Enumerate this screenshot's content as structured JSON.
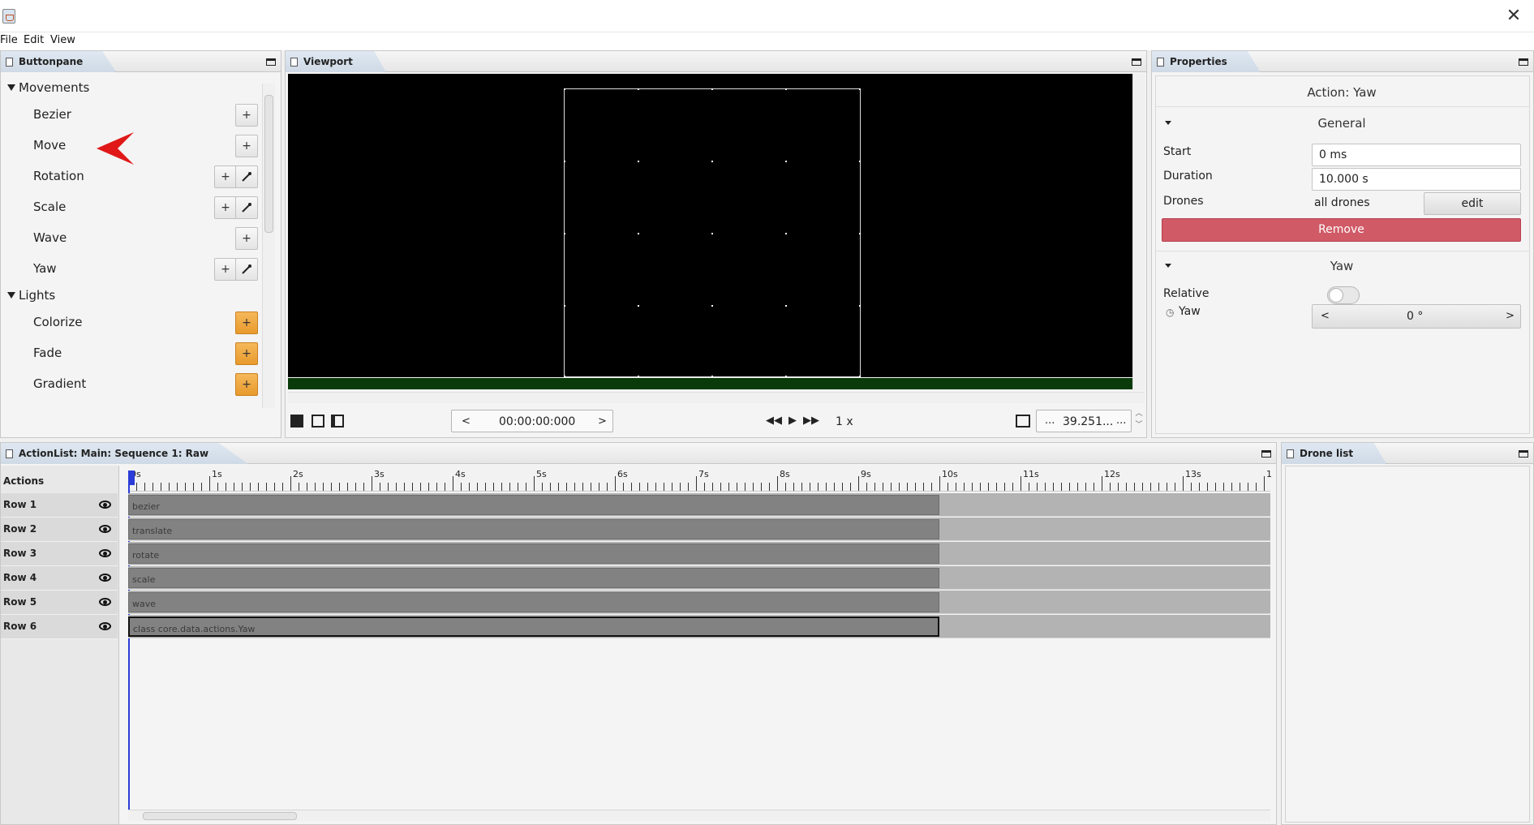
{
  "window": {
    "close_glyph": "✕"
  },
  "menu": [
    "File",
    "Edit",
    "View"
  ],
  "buttonpane": {
    "tab": "Buttonpane",
    "categories": [
      {
        "label": "Movements",
        "items": [
          {
            "label": "Bezier",
            "buttons": [
              "+"
            ]
          },
          {
            "label": "Move",
            "buttons": [
              "+"
            ]
          },
          {
            "label": "Rotation",
            "buttons": [
              "+",
              "pick"
            ]
          },
          {
            "label": "Scale",
            "buttons": [
              "+",
              "pick"
            ]
          },
          {
            "label": "Wave",
            "buttons": [
              "+"
            ]
          },
          {
            "label": "Yaw",
            "buttons": [
              "+",
              "pick"
            ]
          }
        ]
      },
      {
        "label": "Lights",
        "items": [
          {
            "label": "Colorize",
            "buttons": [
              "+"
            ]
          },
          {
            "label": "Fade",
            "buttons": [
              "+"
            ]
          },
          {
            "label": "Gradient",
            "buttons": [
              "+"
            ]
          }
        ]
      }
    ],
    "accent_orange": "#e89a2c",
    "annotation_arrow_color": "#e01818"
  },
  "viewport": {
    "tab": "Viewport",
    "timecode": "00:00:00:000",
    "timecode_prev": "<",
    "timecode_next": ">",
    "speed": "1 x",
    "zoom_value": "39.251...",
    "zoom_prefix": "...",
    "zoom_suffix": "...",
    "ground_color": "#0a3a0a"
  },
  "properties": {
    "tab": "Properties",
    "title": "Action: Yaw",
    "general": {
      "heading": "General",
      "start_label": "Start",
      "start_value": "0 ms",
      "duration_label": "Duration",
      "duration_value": "10.000 s",
      "drones_label": "Drones",
      "drones_value": "all drones",
      "edit_button": "edit",
      "remove_button": "Remove",
      "remove_color": "#d05a66"
    },
    "yaw": {
      "heading": "Yaw",
      "relative_label": "Relative",
      "yaw_label": "Yaw",
      "yaw_value": "0 °",
      "prev": "<",
      "next": ">"
    }
  },
  "actionlist": {
    "tab": "ActionList: Main: Sequence 1: Raw",
    "header": "Actions",
    "ruler": [
      "0s",
      "1s",
      "2s",
      "3s",
      "4s",
      "5s",
      "6s",
      "7s",
      "8s",
      "9s",
      "10s",
      "11s",
      "12s",
      "13s",
      "1"
    ],
    "rows": [
      {
        "label": "Row 1",
        "clip": "bezier"
      },
      {
        "label": "Row 2",
        "clip": "translate"
      },
      {
        "label": "Row 3",
        "clip": "rotate"
      },
      {
        "label": "Row 4",
        "clip": "scale"
      },
      {
        "label": "Row 5",
        "clip": "wave"
      },
      {
        "label": "Row 6",
        "clip": "class core.data.actions.Yaw"
      }
    ]
  },
  "dronelist": {
    "tab": "Drone list"
  }
}
